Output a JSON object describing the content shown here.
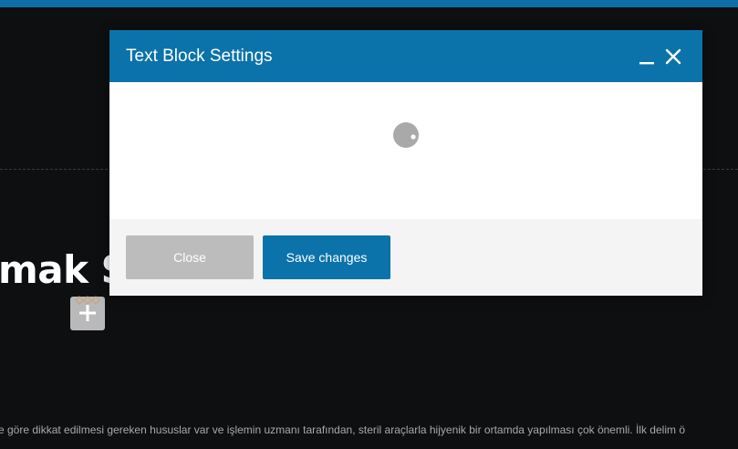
{
  "background": {
    "heading_fragment": "mak S",
    "paragraph_line": "e göre dikkat edilmesi gereken hususlar var ve işlemin uzmanı tarafından, steril araçlarla hijyenik bir ortamda yapılması çok önemli. İlk delim ö",
    "accent_color": "#0d6fa8"
  },
  "add_element": {
    "icon": "plus-icon"
  },
  "modal": {
    "title": "Text Block Settings",
    "minimize_icon": "minimize-icon",
    "close_icon": "close-icon",
    "body": {
      "state": "loading",
      "spinner_icon": "loading-spinner-icon"
    },
    "footer": {
      "close_label": "Close",
      "save_label": "Save changes"
    },
    "header_color": "#0b73aa",
    "secondary_button_color": "#bcbcbc"
  }
}
